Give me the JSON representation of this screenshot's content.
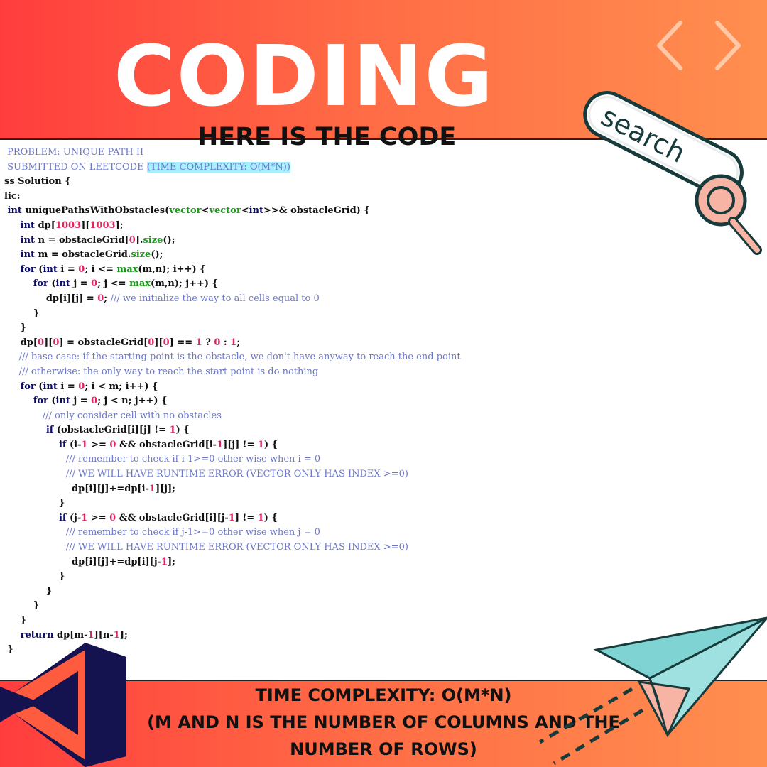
{
  "header": {
    "title": "CODING",
    "subtitle": "HERE IS THE CODE"
  },
  "search_graphic": {
    "label": "search"
  },
  "code": {
    "lines": [
      " PROBLEM: UNIQUE PATH II",
      " SUBMITTED ON LEETCODE (TIME COMPLEXITY: O(M*N))",
      "ss Solution {",
      "lic:",
      " int uniquePathsWithObstacles(vector<vector<int>>& obstacleGrid) {",
      "     int dp[1003][1003];",
      "     int n = obstacleGrid[0].size();",
      "     int m = obstacleGrid.size();",
      "     for (int i = 0; i <= max(m,n); i++) {",
      "         for (int j = 0; j <= max(m,n); j++) {",
      "             dp[i][j] = 0; /// we initialize the way to all cells equal to 0",
      "         }",
      "     }",
      "     dp[0][0] = obstacleGrid[0][0] == 1 ? 0 : 1;",
      "     /// base case: if the starting point is the obstacle, we don't have anyway to reach the end point",
      "     /// otherwise: the only way to reach the start point is do nothing",
      "     for (int i = 0; i < m; i++) {",
      "         for (int j = 0; j < n; j++) {",
      "             /// only consider cell with no obstacles",
      "             if (obstacleGrid[i][j] != 1) {",
      "                 if (i-1 >= 0 && obstacleGrid[i-1][j] != 1) {",
      "                     /// remember to check if i-1>=0 other wise when i = 0",
      "                     /// WE WILL HAVE RUNTIME ERROR (VECTOR ONLY HAS INDEX >=0)",
      "                     dp[i][j]+=dp[i-1][j];",
      "                 }",
      "                 if (j-1 >= 0 && obstacleGrid[i][j-1] != 1) {",
      "                     /// remember to check if j-1>=0 other wise when j = 0",
      "                     /// WE WILL HAVE RUNTIME ERROR (VECTOR ONLY HAS INDEX >=0)",
      "                     dp[i][j]+=dp[i][j-1];",
      "                 }",
      "             }",
      "         }",
      "     }",
      "     return dp[m-1][n-1];",
      " }"
    ]
  },
  "footer": {
    "line1": "TIME COMPLEXITY: O(M*N)",
    "line2": "(M AND N IS THE NUMBER OF COLUMNS AND THE",
    "line3": "NUMBER OF ROWS)"
  },
  "colors": {
    "keyword": "#0b0b6b",
    "comment": "#6a76c8",
    "number": "#e0245e",
    "builtin": "#1a9a1a",
    "accent_teal": "#7fd3d3",
    "accent_pink": "#f7b3a3",
    "logo_navy": "#14134f"
  }
}
